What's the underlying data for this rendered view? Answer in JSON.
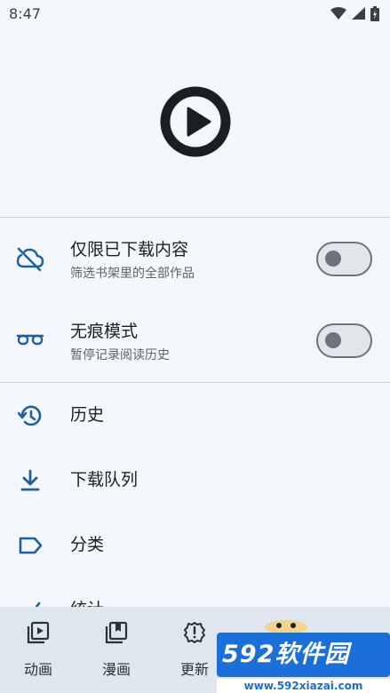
{
  "status_bar": {
    "time": "8:47"
  },
  "colors": {
    "accent": "#1d5fa0",
    "switch_off": "#6d737a",
    "nav_bg": "#dfe6ee"
  },
  "toggles": [
    {
      "title": "仅限已下载内容",
      "subtitle": "筛选书架里的全部作品",
      "icon": "cloud-off-icon",
      "checked": false
    },
    {
      "title": "无痕模式",
      "subtitle": "暂停记录阅读历史",
      "icon": "glasses-icon",
      "checked": false
    }
  ],
  "menu": [
    {
      "label": "历史",
      "icon": "history-icon"
    },
    {
      "label": "下载队列",
      "icon": "download-icon"
    },
    {
      "label": "分类",
      "icon": "label-icon"
    },
    {
      "label": "统计",
      "icon": "stats-icon"
    }
  ],
  "bottom_nav": [
    {
      "label": "动画",
      "icon": "play-box-icon"
    },
    {
      "label": "漫画",
      "icon": "bookmark-book-icon"
    },
    {
      "label": "更新",
      "icon": "alert-circle-icon"
    }
  ],
  "watermark": {
    "brand": "592软件园",
    "url": "www.592xiazai.com"
  }
}
